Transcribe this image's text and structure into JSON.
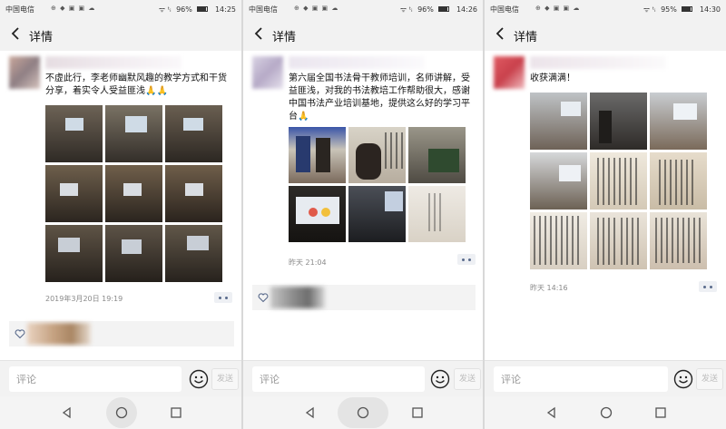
{
  "statusbar": {
    "carrier": "中国电信",
    "icons": "⊕ ◆ ▣ ▣ ☁",
    "signal": "ᯤ ᵗᵢ",
    "battery": [
      "96%",
      "96%",
      "95%"
    ],
    "time": [
      "14:25",
      "14:26",
      "14:30"
    ]
  },
  "header": {
    "title": "详情",
    "back_icon": "arrow-left-icon"
  },
  "posts": [
    {
      "text_lines": [
        "不虚此行，李老师幽默风趣的教学方式和干货",
        "分享，着实令人受益匪浅🙏🙏"
      ],
      "timestamp": "2019年3月20日 19:19"
    },
    {
      "text_lines": [
        "第六届全国书法骨干教师培训，名师讲解，受",
        "益匪浅，对我的书法教培工作帮助很大，感谢",
        "中国书法产业培训基地，提供这么好的学习平",
        "台🙏"
      ],
      "timestamp": "昨天 21:04"
    },
    {
      "text_lines": [
        "收获满满！"
      ],
      "timestamp": "昨天 14:16"
    }
  ],
  "comment": {
    "placeholder": "评论",
    "send_label": "发送"
  },
  "colors": {
    "link_blue": "#5a6b8c",
    "bar_bg": "#f2f2f2"
  }
}
